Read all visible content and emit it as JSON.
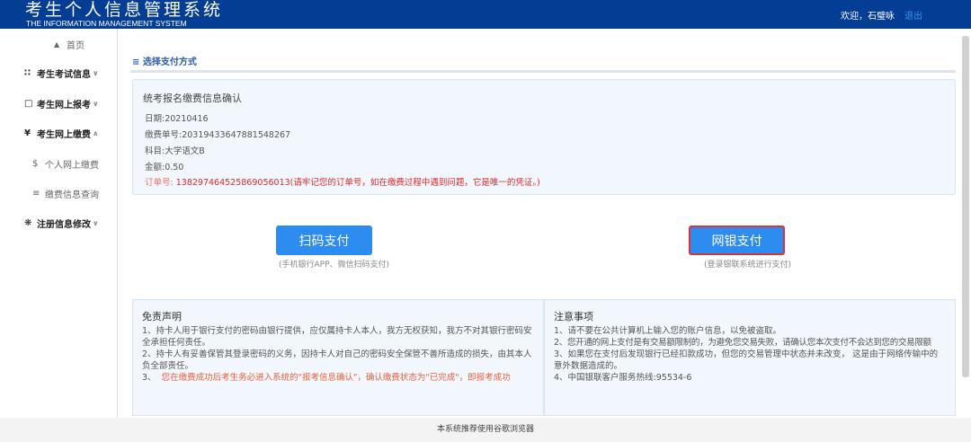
{
  "header": {
    "title": "考生个人信息管理系统",
    "subtitle": "THE INFORMATION MANAGEMENT SYSTEM",
    "welcome": "欢迎，石璧咏",
    "logout": "退出"
  },
  "sidebar": {
    "items": [
      {
        "label": "首页",
        "icon": "home-icon"
      },
      {
        "label": "考生考试信息",
        "icon": "grid-icon"
      },
      {
        "label": "考生网上报考",
        "icon": "monitor-icon"
      },
      {
        "label": "考生网上缴费",
        "icon": "yen-icon"
      },
      {
        "label": "个人网上缴费",
        "icon": "dollar-icon"
      },
      {
        "label": "缴费信息查询",
        "icon": "list-icon"
      },
      {
        "label": "注册信息修改",
        "icon": "gear-icon"
      }
    ]
  },
  "main": {
    "section_title": "选择支付方式",
    "info": {
      "title": "统考报名缴费信息确认",
      "date": "日期:20210416",
      "bill_no": "缴费单号:20319433647881548267",
      "subject": "科目:大学语文B",
      "amount": "金额:0.50",
      "order_label": "订单号:",
      "order_text": "138297464525869056013(请牢记您的订单号，如在缴费过程中遇到问题，它是唯一的凭证。)"
    },
    "pay": {
      "qr_label": "扫码支付",
      "qr_hint": "(手机银行APP、微信扫码支付)",
      "bank_label": "网银支付",
      "bank_hint": "(登录银联系统进行支付)"
    },
    "disclaimer": {
      "title": "免责声明",
      "items": [
        "1、持卡人用于银行支付的密码由银行提供，应仅属持卡人本人，我方无权获知，我方不对其银行密码安全承担任何责任。",
        "2、持卡人有妥善保管其登录密码的义务，因持卡人对自己的密码安全保管不善所造成的损失，由其本人负全部责任。",
        "3、"
      ],
      "red_item": "您在缴费成功后考生务必进入系统的\"报考信息确认\"，确认缴费状态为\"已完成\"，即报考成功"
    },
    "notes": {
      "title": "注意事项",
      "items": [
        "1、请不要在公共计算机上输入您的账户信息，以免被盗取。",
        "2、您开通的网上支付是有交易额限制的，为避免您交易失败，请确认您本次支付不会达到您的交易限额",
        "3、如果您在支付后发现银行已经扣款成功，但您的交易管理中状态并未改变， 这是由于网络传输中的意外数据造成的。",
        "4、中国银联客户服务热线:95534-6"
      ]
    }
  },
  "footer": {
    "text": "本系统推荐使用谷歌浏览器"
  },
  "colors": {
    "header": "#033d94",
    "button": "#2d8cf0",
    "selected_border": "#d9343b",
    "warning": "#e8262b"
  }
}
